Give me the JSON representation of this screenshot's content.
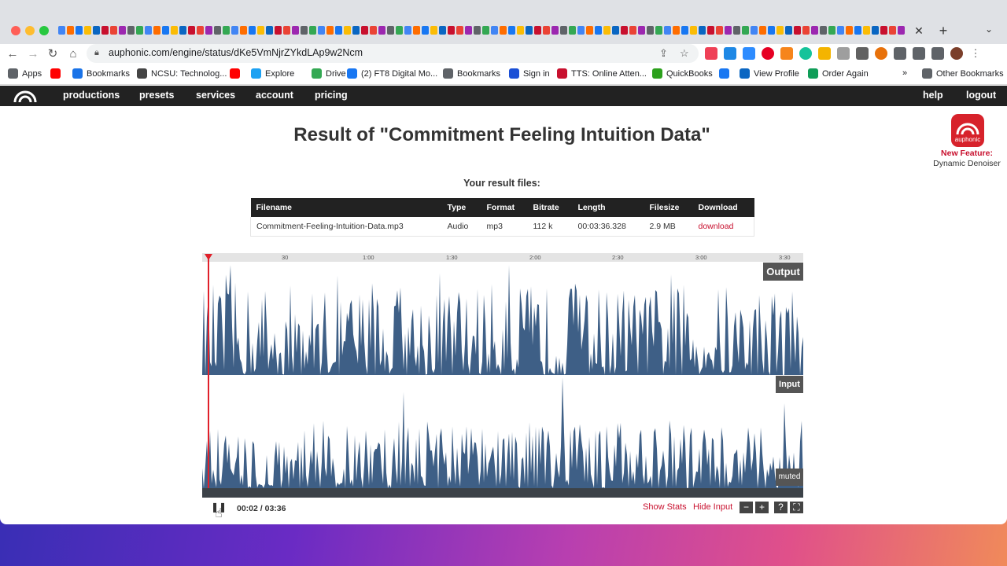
{
  "browser": {
    "url": "auphonic.com/engine/status/dKe5VmNjrZYkdLAp9w2Ncm",
    "tab_close": "✕",
    "tab_new": "+",
    "bookmarks": [
      {
        "label": "Apps",
        "icon": "apps-grid-icon",
        "color": "#5f6368"
      },
      {
        "label": "",
        "icon": "youtube-icon",
        "color": "#ff0000"
      },
      {
        "label": "Bookmarks",
        "icon": "star-icon",
        "color": "#1a73e8"
      },
      {
        "label": "NCSU: Technolog...",
        "icon": "globe-icon",
        "color": "#444444"
      },
      {
        "label": "",
        "icon": "youtube-icon",
        "color": "#ff0000"
      },
      {
        "label": "Explore",
        "icon": "twitter-icon",
        "color": "#1da1f2"
      },
      {
        "label": "Drive",
        "icon": "drive-icon",
        "color": "#34a853"
      },
      {
        "label": "(2) FT8 Digital Mo...",
        "icon": "facebook-icon",
        "color": "#1877f2"
      },
      {
        "label": "Bookmarks",
        "icon": "folder-icon",
        "color": "#5f6368"
      },
      {
        "label": "Sign in",
        "icon": "c-logo-icon",
        "color": "#1a4fd6"
      },
      {
        "label": "TTS: Online Atten...",
        "icon": "s-logo-icon",
        "color": "#c8102e"
      },
      {
        "label": "QuickBooks",
        "icon": "quickbooks-icon",
        "color": "#2ca01c"
      },
      {
        "label": "",
        "icon": "facebook-icon",
        "color": "#1877f2"
      },
      {
        "label": "View Profile",
        "icon": "linkedin-icon",
        "color": "#0a66c2"
      },
      {
        "label": "Order Again",
        "icon": "g-logo-icon",
        "color": "#0f9d58"
      }
    ],
    "bookmarks_overflow": "»",
    "other_bookmarks": "Other Bookmarks"
  },
  "site_nav": {
    "links": [
      "productions",
      "presets",
      "services",
      "account",
      "pricing"
    ],
    "right_links": [
      "help",
      "logout"
    ]
  },
  "page": {
    "title": "Result of \"Commitment Feeling Intuition Data\"",
    "promo_icon_text": "auphonic",
    "promo_title": "New Feature:",
    "promo_subtitle": "Dynamic Denoiser"
  },
  "files": {
    "heading": "Your result files:",
    "columns": [
      "Filename",
      "Type",
      "Format",
      "Bitrate",
      "Length",
      "Filesize",
      "Download"
    ],
    "rows": [
      [
        "Commitment-Feeling-Intuition-Data.mp3",
        "Audio",
        "mp3",
        "112 k",
        "00:03:36.328",
        "2.9 MB",
        "download"
      ]
    ]
  },
  "player": {
    "ticks": [
      "30",
      "1:00",
      "1:30",
      "2:00",
      "2:30",
      "3:00",
      "3:30"
    ],
    "output_label": "Output",
    "input_label": "Input",
    "muted_label": "muted",
    "time": "00:02 / 03:36",
    "pause_icon": "❚❚",
    "show_stats": "Show Stats",
    "hide_input": "Hide Input",
    "btn_minus": "−",
    "btn_plus": "+",
    "btn_help": "?",
    "btn_fullscreen": "⛶",
    "waveform_color": "#3e5f86",
    "playhead_color": "#e0202a"
  }
}
